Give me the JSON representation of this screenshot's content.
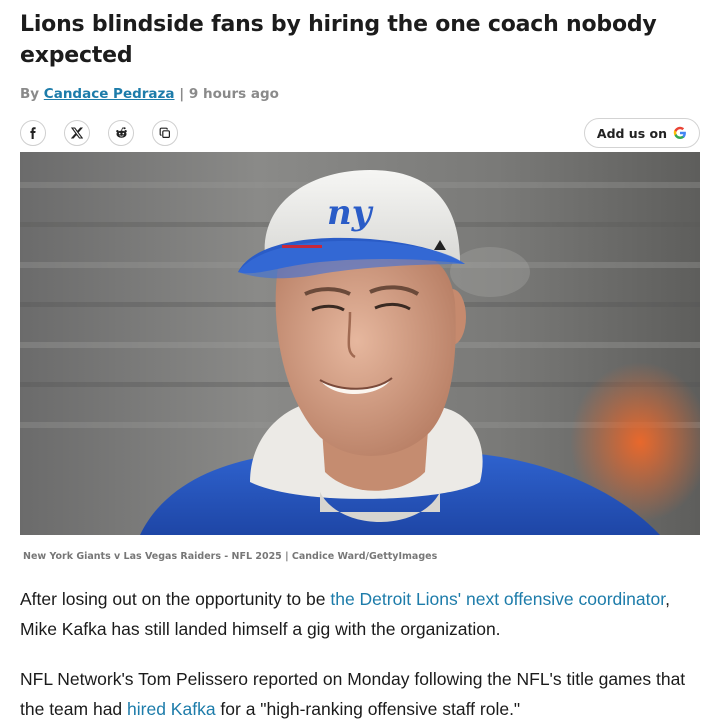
{
  "article": {
    "headline": "Lions blindside fans by hiring the one coach nobody expected",
    "byline_prefix": "By",
    "author": "Candace Pedraza",
    "separator": "|",
    "time_ago": "9 hours ago"
  },
  "share": {
    "buttons": [
      {
        "name": "facebook",
        "icon": "facebook-icon"
      },
      {
        "name": "x",
        "icon": "x-icon"
      },
      {
        "name": "reddit",
        "icon": "reddit-icon"
      },
      {
        "name": "copy-link",
        "icon": "copy-icon"
      }
    ],
    "add_us_label": "Add us on",
    "add_us_brand": "G"
  },
  "image": {
    "alt_subject": "Coach in white ny cap and blue jacket",
    "cap_text": "ny",
    "caption": "New York Giants v Las Vegas Raiders - NFL 2025 | Candice Ward/GettyImages"
  },
  "body": {
    "p1_before": "After losing out on the opportunity to be ",
    "p1_link": "the Detroit Lions' next offensive coordinator",
    "p1_after": ", Mike Kafka has still landed himself a gig with the organization.",
    "p2_before": "NFL Network's Tom Pelissero reported on Monday following the NFL's title games that the team had ",
    "p2_link": "hired Kafka",
    "p2_after": " for a \"high-ranking offensive staff role.\""
  },
  "colors": {
    "link": "#1d7caa",
    "giants_blue": "#2a5cc7",
    "text": "#1b1b1b"
  }
}
